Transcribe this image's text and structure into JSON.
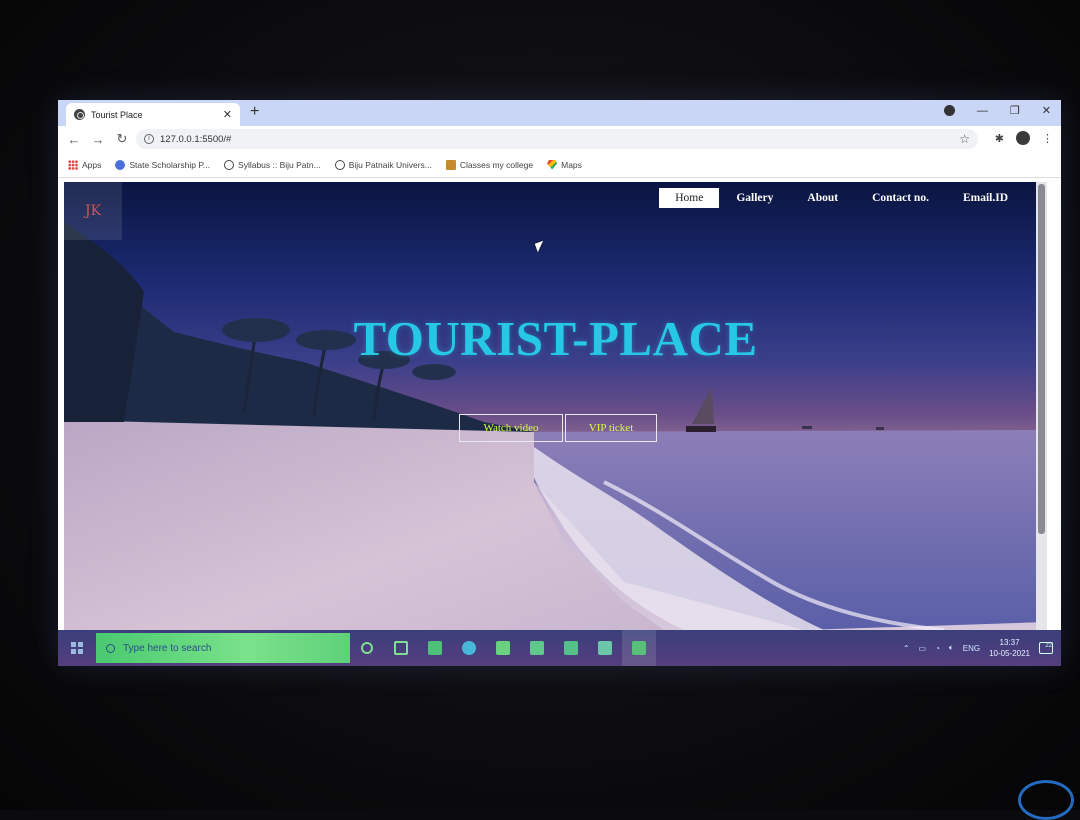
{
  "browser": {
    "tab_title": "Tourist Place",
    "new_tab": "+",
    "url": "127.0.0.1:5500/#",
    "bookmarks": [
      {
        "label": "Apps",
        "icon": "apps-icon"
      },
      {
        "label": "State Scholarship P...",
        "icon": "scholarship-icon"
      },
      {
        "label": "Syllabus :: Biju Patn...",
        "icon": "globe-icon"
      },
      {
        "label": "Biju Patnaik Univers...",
        "icon": "globe-icon"
      },
      {
        "label": "Classes my college",
        "icon": "classroom-icon"
      },
      {
        "label": "Maps",
        "icon": "maps-icon"
      }
    ]
  },
  "site": {
    "logo": "JK",
    "nav": [
      {
        "label": "Home",
        "active": true
      },
      {
        "label": "Gallery",
        "active": false
      },
      {
        "label": "About",
        "active": false
      },
      {
        "label": "Contact no.",
        "active": false
      },
      {
        "label": "Email.ID",
        "active": false
      }
    ],
    "hero_title": "TOURIST-PLACE",
    "buttons": {
      "watch": "Watch video",
      "vip": "VIP ticket"
    },
    "colors": {
      "title": "#27c8e6",
      "button_text": "#d7ff4a"
    }
  },
  "taskbar": {
    "search_placeholder": "Type here to search",
    "language": "ENG",
    "time": "13:37",
    "date": "10-05-2021",
    "notifications": "22"
  }
}
